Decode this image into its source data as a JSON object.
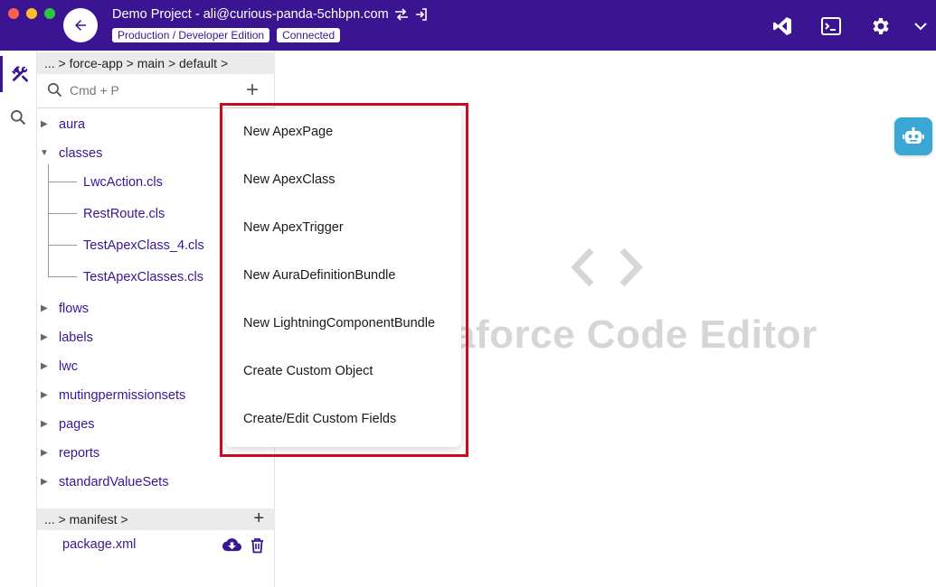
{
  "window": {
    "title": "Demo Project - ali@curious-panda-5chbpn.com",
    "badges": [
      "Production / Developer Edition",
      "Connected"
    ]
  },
  "toolbar_icons": [
    "vscode-icon",
    "terminal-icon",
    "gear-icon",
    "chevron-down-icon"
  ],
  "activity_bar": [
    "tools-icon",
    "search-icon"
  ],
  "explorer": {
    "breadcrumb": "... > force-app > main > default >",
    "search_placeholder": "Cmd + P",
    "tree": [
      {
        "label": "aura",
        "type": "folder",
        "expanded": false
      },
      {
        "label": "classes",
        "type": "folder",
        "expanded": true
      },
      {
        "label": "LwcAction.cls",
        "type": "file"
      },
      {
        "label": "RestRoute.cls",
        "type": "file"
      },
      {
        "label": "TestApexClass_4.cls",
        "type": "file"
      },
      {
        "label": "TestApexClasses.cls",
        "type": "file"
      },
      {
        "label": "flows",
        "type": "folder",
        "expanded": false
      },
      {
        "label": "labels",
        "type": "folder",
        "expanded": false
      },
      {
        "label": "lwc",
        "type": "folder",
        "expanded": false
      },
      {
        "label": "mutingpermissionsets",
        "type": "folder",
        "expanded": false
      },
      {
        "label": "pages",
        "type": "folder",
        "expanded": false
      },
      {
        "label": "reports",
        "type": "folder",
        "expanded": false
      },
      {
        "label": "standardValueSets",
        "type": "folder",
        "expanded": false
      }
    ],
    "manifest_breadcrumb": "... > manifest >",
    "manifest_file": "package.xml"
  },
  "editor": {
    "watermark": "aforce Code Editor"
  },
  "context_menu": {
    "items": [
      "New ApexPage",
      "New ApexClass",
      "New ApexTrigger",
      "New AuraDefinitionBundle",
      "New LightningComponentBundle",
      "Create Custom Object",
      "Create/Edit Custom Fields"
    ]
  },
  "colors": {
    "brand": "#3b1591",
    "highlight": "#cc0a1f",
    "assistant": "#3aa7d4"
  }
}
